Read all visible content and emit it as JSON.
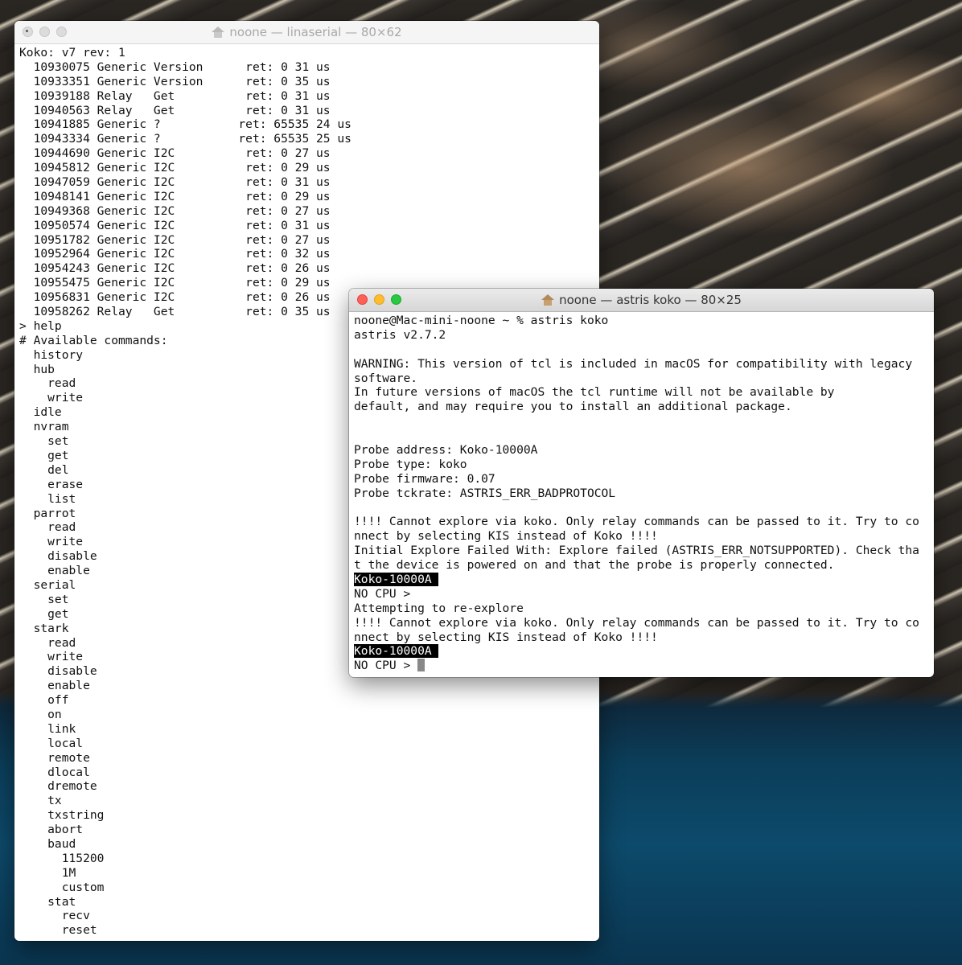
{
  "windows": {
    "back": {
      "title": "noone — linaserial — 80×62",
      "lines": [
        "Koko: v7 rev: 1",
        "  10930075 Generic Version      ret: 0 31 us",
        "  10933351 Generic Version      ret: 0 35 us",
        "  10939188 Relay   Get          ret: 0 31 us",
        "  10940563 Relay   Get          ret: 0 31 us",
        "  10941885 Generic ?           ret: 65535 24 us",
        "  10943334 Generic ?           ret: 65535 25 us",
        "  10944690 Generic I2C          ret: 0 27 us",
        "  10945812 Generic I2C          ret: 0 29 us",
        "  10947059 Generic I2C          ret: 0 31 us",
        "  10948141 Generic I2C          ret: 0 29 us",
        "  10949368 Generic I2C          ret: 0 27 us",
        "  10950574 Generic I2C          ret: 0 31 us",
        "  10951782 Generic I2C          ret: 0 27 us",
        "  10952964 Generic I2C          ret: 0 32 us",
        "  10954243 Generic I2C          ret: 0 26 us",
        "  10955475 Generic I2C          ret: 0 29 us",
        "  10956831 Generic I2C          ret: 0 26 us",
        "  10958262 Relay   Get          ret: 0 35 us",
        "> help",
        "# Available commands:",
        "  history",
        "  hub",
        "    read",
        "    write",
        "  idle",
        "  nvram",
        "    set",
        "    get",
        "    del",
        "    erase",
        "    list",
        "  parrot",
        "    read",
        "    write",
        "    disable",
        "    enable",
        "  serial",
        "    set",
        "    get",
        "  stark",
        "    read",
        "    write",
        "    disable",
        "    enable",
        "    off",
        "    on",
        "    link",
        "    local",
        "    remote",
        "    dlocal",
        "    dremote",
        "    tx",
        "    txstring",
        "    abort",
        "    baud",
        "      115200",
        "      1M",
        "      custom",
        "    stat",
        "      recv",
        "      reset"
      ]
    },
    "front": {
      "title": "noone — astris koko — 80×25",
      "lines": [
        {
          "text": "noone@Mac-mini-noone ~ % astris koko"
        },
        {
          "text": "astris v2.7.2"
        },
        {
          "text": ""
        },
        {
          "text": "WARNING: This version of tcl is included in macOS for compatibility with legacy"
        },
        {
          "text": "software."
        },
        {
          "text": "In future versions of macOS the tcl runtime will not be available by"
        },
        {
          "text": "default, and may require you to install an additional package."
        },
        {
          "text": ""
        },
        {
          "text": ""
        },
        {
          "text": "Probe address: Koko-10000A"
        },
        {
          "text": "Probe type: koko"
        },
        {
          "text": "Probe firmware: 0.07"
        },
        {
          "text": "Probe tckrate: ASTRIS_ERR_BADPROTOCOL"
        },
        {
          "text": ""
        },
        {
          "text": "!!!! Cannot explore via koko. Only relay commands can be passed to it. Try to co"
        },
        {
          "text": "nnect by selecting KIS instead of Koko !!!!"
        },
        {
          "text": "Initial Explore Failed With: Explore failed (ASTRIS_ERR_NOTSUPPORTED). Check tha"
        },
        {
          "text": "t the device is powered on and that the probe is properly connected."
        },
        {
          "text": "Koko-10000A",
          "highlight": true
        },
        {
          "text": "NO CPU >"
        },
        {
          "text": "Attempting to re-explore"
        },
        {
          "text": "!!!! Cannot explore via koko. Only relay commands can be passed to it. Try to co"
        },
        {
          "text": "nnect by selecting KIS instead of Koko !!!!"
        },
        {
          "text": "Koko-10000A",
          "highlight": true
        },
        {
          "text": "NO CPU > ",
          "cursor": true
        }
      ]
    }
  },
  "colors": {
    "close": "#fe5f57",
    "minimize": "#febc2e",
    "zoom": "#28c840"
  }
}
